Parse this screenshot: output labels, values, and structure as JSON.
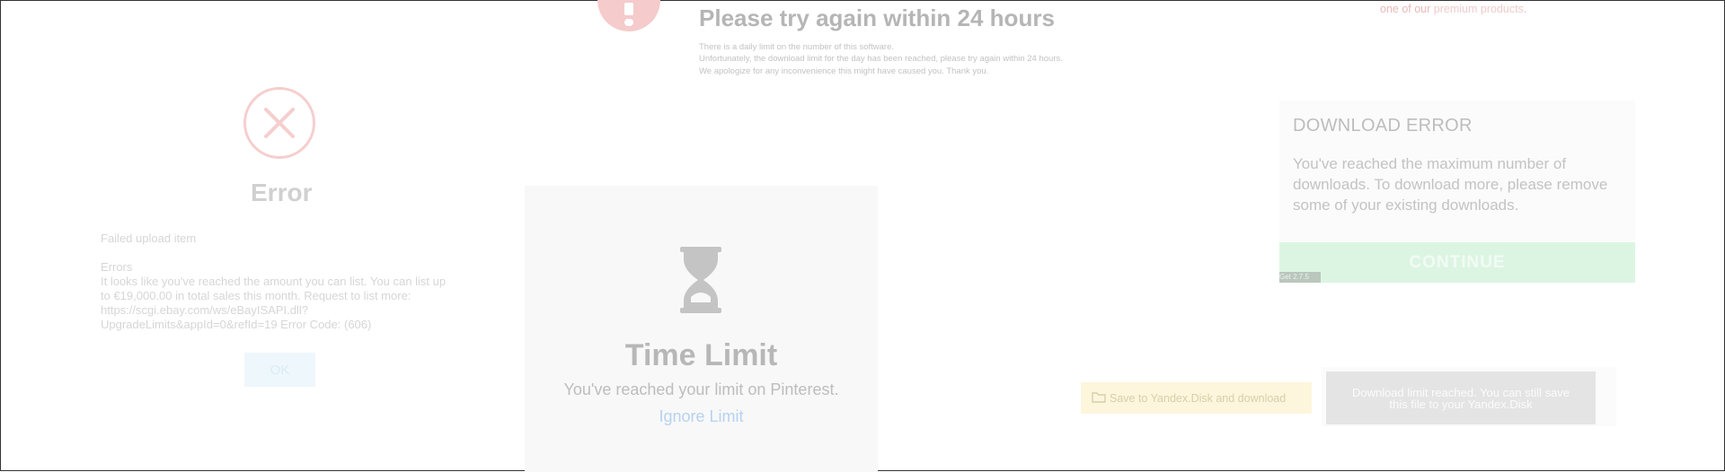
{
  "retry_notice": {
    "title": "Please try again within 24 hours",
    "lines": [
      "There is a daily limit on the number of this software.",
      "Unfortunately, the download limit for the day has been reached, please try again within 24 hours.",
      "We apologize for any inconvenience this might have caused you. Thank you."
    ]
  },
  "premium_promo": {
    "prefix": "one of our",
    "link": "premium products",
    "suffix": "."
  },
  "error_dialog": {
    "title": "Error",
    "failed_label": "Failed upload item",
    "errors_label": "Errors",
    "message": "It looks like you've reached the amount you can list. You can list up to €19,000.00 in total sales this month. Request to list more: https://scgi.ebay.com/ws/eBayISAPI.dll?UpgradeLimits&appId=0&refId=19 Error Code: (606)",
    "ok_label": "OK"
  },
  "pinterest": {
    "title": "Time Limit",
    "subtitle": "You've reached your limit on Pinterest.",
    "ignore_label": "Ignore Limit"
  },
  "download_error": {
    "title": "DOWNLOAD ERROR",
    "message": "You've reached the maximum number of downloads. To download more, please remove some of your existing downloads.",
    "continue_label": "CONTINUE",
    "badge": "Get 2.7.5"
  },
  "yandex": {
    "button_label": "Save to Yandex.Disk and download",
    "tooltip": "Download limit reached. You can still save this file to your Yandex.Disk"
  },
  "icons": {
    "warning": "exclamation-icon",
    "error": "close-circle-icon",
    "hourglass": "hourglass-icon",
    "yandex": "disk-icon"
  },
  "colors": {
    "error_red": "#f6cece",
    "continue_green": "#dcf5e2",
    "link_blue": "#b6d3ee",
    "yandex_yellow": "#fdf6dd"
  }
}
